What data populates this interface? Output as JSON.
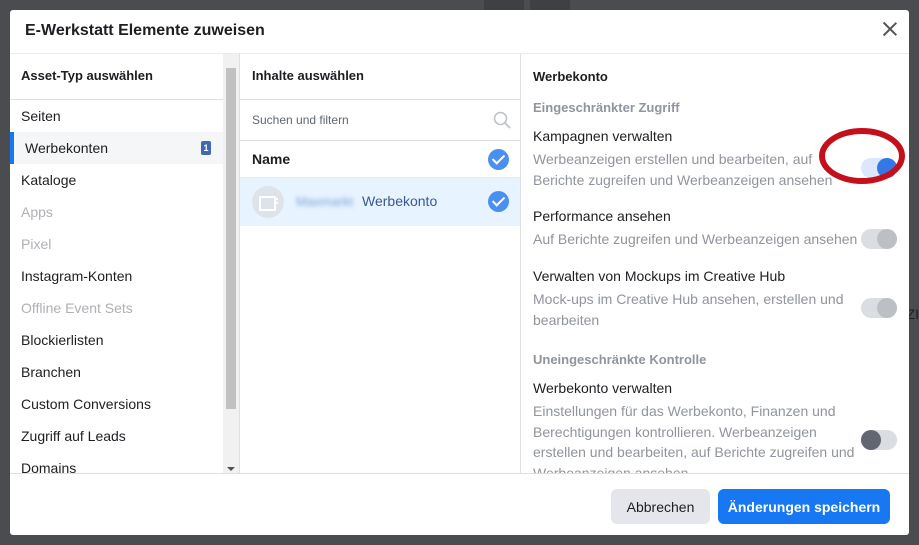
{
  "modal": {
    "title": "E-Werkstatt Elemente zuweisen"
  },
  "background": {
    "peek_text": "ZI"
  },
  "left_column": {
    "heading": "Asset-Typ auswählen",
    "items": [
      {
        "label": "Seiten",
        "state": "normal"
      },
      {
        "label": "Werbekonten",
        "state": "selected",
        "badge": "1"
      },
      {
        "label": "Kataloge",
        "state": "normal"
      },
      {
        "label": "Apps",
        "state": "disabled"
      },
      {
        "label": "Pixel",
        "state": "disabled"
      },
      {
        "label": "Instagram-Konten",
        "state": "normal"
      },
      {
        "label": "Offline Event Sets",
        "state": "disabled"
      },
      {
        "label": "Blockierlisten",
        "state": "normal"
      },
      {
        "label": "Branchen",
        "state": "normal"
      },
      {
        "label": "Custom Conversions",
        "state": "normal"
      },
      {
        "label": "Zugriff auf Leads",
        "state": "normal"
      },
      {
        "label": "Domains",
        "state": "normal"
      }
    ]
  },
  "middle_column": {
    "heading": "Inhalte auswählen",
    "search_placeholder": "Suchen und filtern",
    "name_header": "Name",
    "account": {
      "blurred_prefix": "Maxmarkt",
      "name": "Werbekonto"
    }
  },
  "right_column": {
    "heading": "Werbekonto",
    "restricted_section": "Eingeschränkter Zugriff",
    "unrestricted_section": "Uneingeschränkte Kontrolle",
    "permissions": [
      {
        "title": "Kampagnen verwalten",
        "description": "Werbeanzeigen erstellen und bearbeiten, auf Berichte zugreifen und Werbeanzeigen ansehen",
        "enabled": true
      },
      {
        "title": "Performance ansehen",
        "description": "Auf Berichte zugreifen und Werbeanzeigen ansehen",
        "enabled": true
      },
      {
        "title": "Verwalten von Mockups im Creative Hub",
        "description": "Mock-ups im Creative Hub ansehen, erstellen und bearbeiten",
        "enabled": true
      },
      {
        "title": "Werbekonto verwalten",
        "description": "Einstellungen für das Werbekonto, Finanzen und Berechtigungen kontrollieren. Werbeanzeigen erstellen und bearbeiten, auf Berichte zugreifen und Werbeanzeigen ansehen",
        "enabled": false
      }
    ]
  },
  "footer": {
    "cancel_label": "Abbrechen",
    "save_label": "Änderungen speichern"
  },
  "colors": {
    "accent": "#1877f2",
    "highlight_ring": "#c4101b"
  }
}
